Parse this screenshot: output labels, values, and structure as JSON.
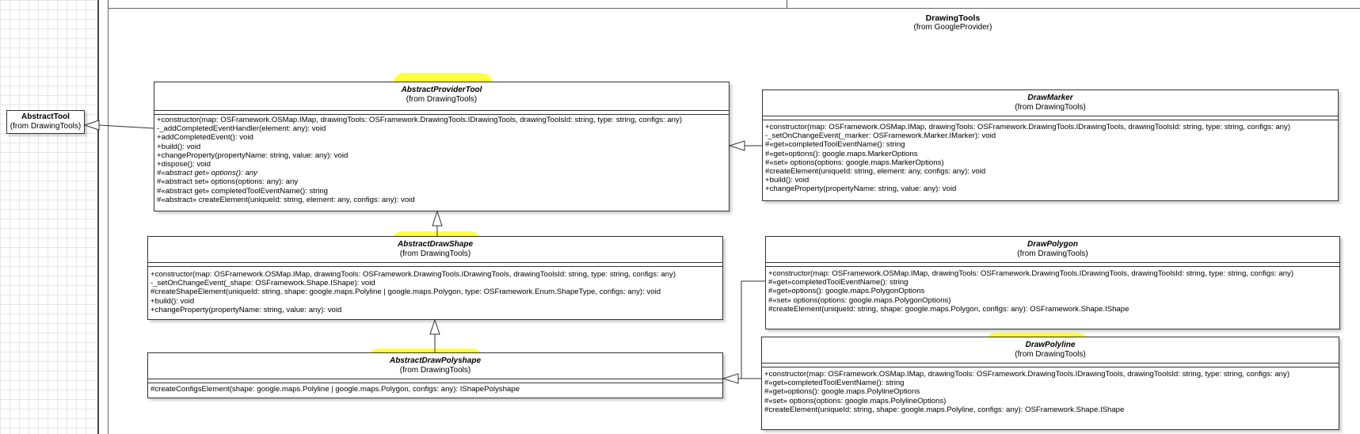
{
  "package": {
    "name": "DrawingTools",
    "from": "(from GoogleProvider)"
  },
  "abstract_tool": {
    "name": "AbstractTool",
    "from": "(from DrawingTools)"
  },
  "classes": {
    "abstract_provider_tool": {
      "name": "AbstractProviderTool",
      "from": "(from DrawingTools)",
      "ops": [
        "+constructor(map: OSFramework.OSMap.IMap, drawingTools: OSFramework.DrawingTools.IDrawingTools, drawingToolsId: string, type: string, configs: any)",
        "-_addCompletedEventHandler(element: any): void",
        "+addCompletedEvent(): void",
        "+build(): void",
        "+changeProperty(propertyName: string, value: any): void",
        "+dispose(): void",
        "#«abstract get» options(): any",
        "#«abstract set» options(options: any): any",
        "#«abstract get» completedToolEventName(): string",
        "#«abstract» createElement(uniqueId: string, element: any, configs: any): void"
      ]
    },
    "abstract_draw_shape": {
      "name": "AbstractDrawShape",
      "from": "(from DrawingTools)",
      "ops": [
        "+constructor(map: OSFramework.OSMap.IMap, drawingTools: OSFramework.DrawingTools.IDrawingTools, drawingToolsId: string, type: string, configs: any)",
        "-_setOnChangeEvent(_shape: OSFramework.Shape.IShape): void",
        "#createShapeElement(uniqueId: string, shape: google.maps.Polyline | google.maps.Polygon, type: OSFramework.Enum.ShapeType, configs: any): void",
        "+build(): void",
        "+changeProperty(propertyName: string, value: any): void"
      ]
    },
    "abstract_draw_polyshape": {
      "name": "AbstractDrawPolyshape",
      "from": "(from DrawingTools)",
      "ops": [
        "#createConfigsElement(shape: google.maps.Polyline | google.maps.Polygon, configs: any): IShapePolyshape"
      ]
    },
    "draw_marker": {
      "name": "DrawMarker",
      "from": "(from DrawingTools)",
      "ops": [
        "+constructor(map: OSFramework.OSMap.IMap, drawingTools: OSFramework.DrawingTools.IDrawingTools, drawingToolsId: string, type: string, configs: any)",
        "-_setOnChangeEvent(_marker: OSFramework.Marker.IMarker): void",
        "#«get»completedToolEventName(): string",
        "#«get»options(): google.maps.MarkerOptions",
        "#«set» options(options: google.maps.MarkerOptions)",
        "#createElement(uniqueId: string, element: any, configs: any): void",
        "+build(): void",
        "+changeProperty(propertyName: string, value: any): void"
      ]
    },
    "draw_polygon": {
      "name": "DrawPolygon",
      "from": "(from DrawingTools)",
      "ops": [
        "+constructor(map: OSFramework.OSMap.IMap, drawingTools: OSFramework.DrawingTools.IDrawingTools, drawingToolsId: string, type: string, configs: any)",
        "#«get»completedToolEventName(): string",
        "#«get»options(): google.maps.PolygonOptions",
        "#«set» options(options: google.maps.PolygonOptions)",
        "#createElement(uniqueId: string, shape: google.maps.Polygon, configs: any): OSFramework.Shape.IShape"
      ]
    },
    "draw_polyline": {
      "name": "DrawPolyline",
      "from": "(from DrawingTools)",
      "ops": [
        "+constructor(map: OSFramework.OSMap.IMap, drawingTools: OSFramework.DrawingTools.IDrawingTools, drawingToolsId: string, type: string, configs: any)",
        "#«get»completedToolEventName(): string",
        "#«get»options(): google.maps.PolylineOptions",
        "#«set» options(options: google.maps.PolylineOptions)",
        "#createElement(uniqueId: string, shape: google.maps.Polyline, configs: any): OSFramework.Shape.IShape"
      ]
    }
  },
  "colors": {
    "highlight": "#ffff33",
    "border": "#333333"
  }
}
